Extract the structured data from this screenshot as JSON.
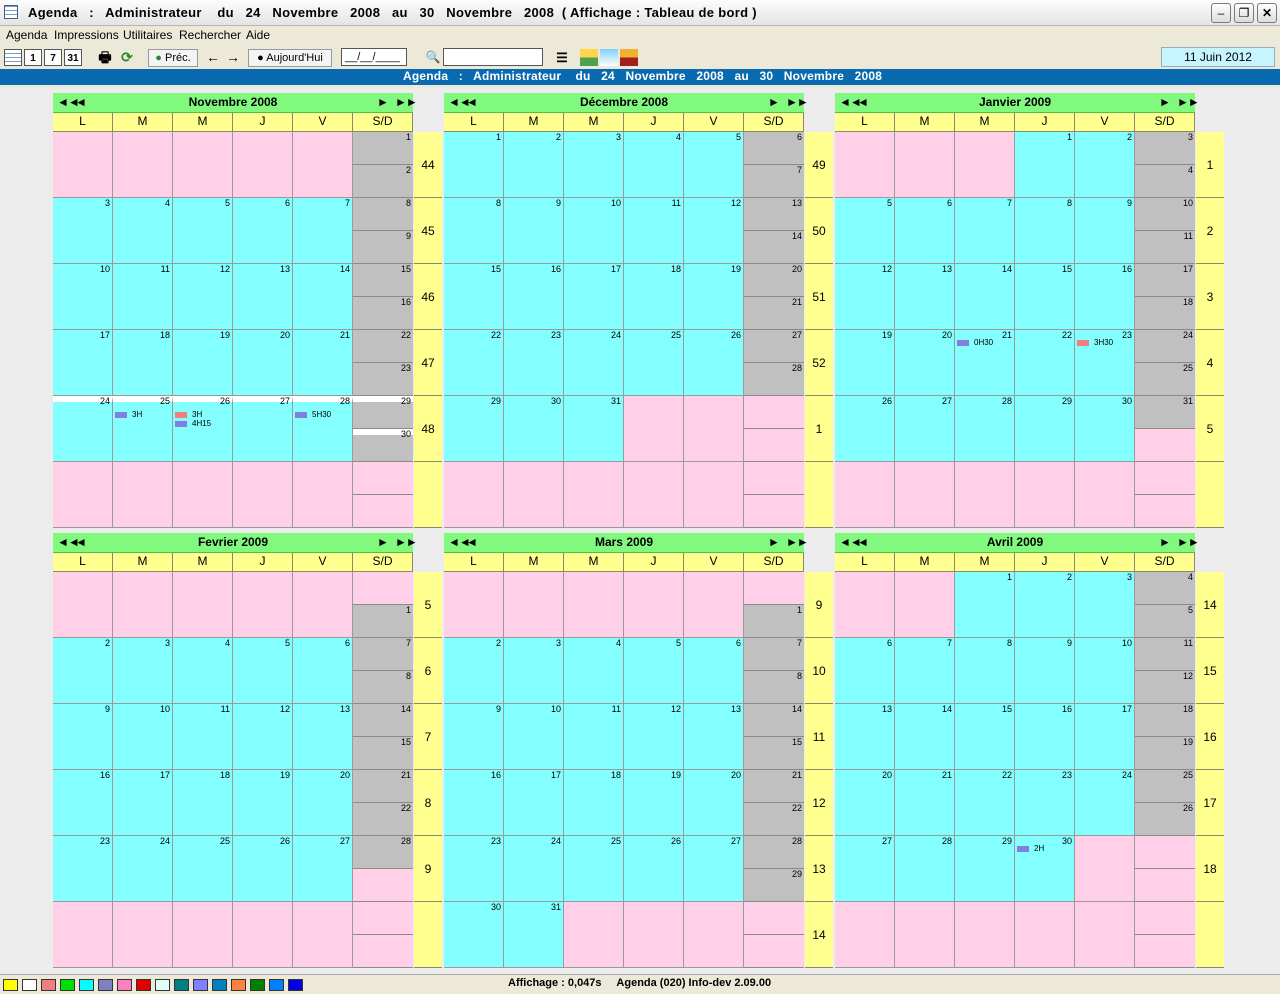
{
  "window": {
    "title": "Agenda   :   Administrateur    du   24   Novembre   2008   au   30   Novembre   2008  ( Affichage : Tableau de bord )"
  },
  "menu": [
    "Agenda",
    "Impressions",
    "Utilitaires",
    "Rechercher",
    "Aide"
  ],
  "toolbar": {
    "prev_label": "Préc.",
    "today_label": "Aujourd'Hui",
    "date_placeholder": "__/__/____",
    "current_date": "11 Juin 2012"
  },
  "banner": "Agenda   :   Administrateur    du   24   Novembre   2008   au   30   Novembre   2008",
  "day_headers": [
    "L",
    "M",
    "M",
    "J",
    "V",
    "S/D"
  ],
  "nav": {
    "first": "◄◄",
    "prev": "◄",
    "next": "►",
    "last": "►►"
  },
  "months": [
    {
      "name": "Novembre   2008",
      "offset": 5,
      "days": 30,
      "weeks": [
        "44",
        "45",
        "46",
        "47",
        "48",
        ""
      ],
      "current_week_row": 4
    },
    {
      "name": "Décembre   2008",
      "offset": 0,
      "days": 31,
      "weeks": [
        "49",
        "50",
        "51",
        "52",
        "1",
        ""
      ]
    },
    {
      "name": "Janvier   2009",
      "offset": 3,
      "days": 31,
      "weeks": [
        "1",
        "2",
        "3",
        "4",
        "5",
        ""
      ]
    },
    {
      "name": "Fevrier   2009",
      "offset": 6,
      "days": 28,
      "weeks": [
        "5",
        "6",
        "7",
        "8",
        "9",
        ""
      ]
    },
    {
      "name": "Mars   2009",
      "offset": 6,
      "days": 31,
      "weeks": [
        "9",
        "10",
        "11",
        "12",
        "13",
        "14"
      ]
    },
    {
      "name": "Avril   2009",
      "offset": 2,
      "days": 30,
      "weeks": [
        "14",
        "15",
        "16",
        "17",
        "18",
        ""
      ]
    }
  ],
  "events": [
    {
      "month": 0,
      "day": 25,
      "label": "3H",
      "color": "#8080e0"
    },
    {
      "month": 0,
      "day": 26,
      "label": "3H",
      "color": "#f08080"
    },
    {
      "month": 0,
      "day": 26,
      "label": "4H15",
      "color": "#8080e0"
    },
    {
      "month": 0,
      "day": 28,
      "label": "5H30",
      "color": "#8080e0"
    },
    {
      "month": 2,
      "day": 21,
      "label": "0H30",
      "color": "#8080e0"
    },
    {
      "month": 2,
      "day": 23,
      "label": "3H30",
      "color": "#f08080"
    },
    {
      "month": 5,
      "day": 30,
      "label": "2H",
      "color": "#8080e0"
    }
  ],
  "palette": [
    "#ffff00",
    "#ffffff",
    "#f08080",
    "#00e000",
    "#00ffff",
    "#8080c0",
    "#ff80c0",
    "#e00000",
    "#e0fff8",
    "#008080",
    "#8080ff",
    "#0080c0",
    "#ff8040",
    "#008000",
    "#0080ff",
    "#0000e0"
  ],
  "status": "Affichage : 0,047s     Agenda (020) Info-dev 2.09.00"
}
